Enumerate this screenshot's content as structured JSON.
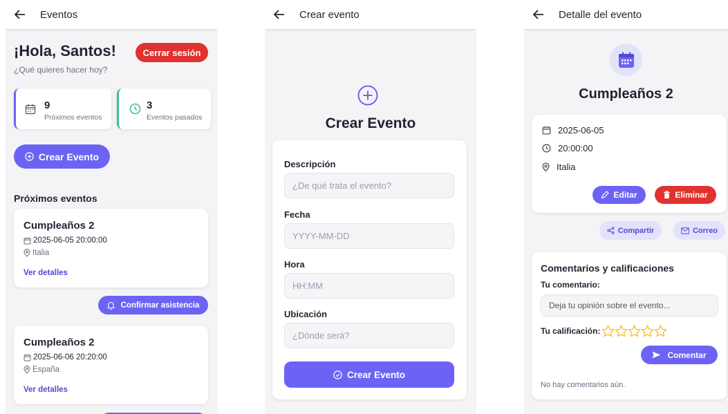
{
  "screen1": {
    "appbar_title": "Eventos",
    "greeting": "¡Hola, Santos!",
    "subtitle": "¿Qué quieres hacer hoy?",
    "logout_label": "Cerrar sesión",
    "stats": [
      {
        "value": "9",
        "label": "Próximos eventos"
      },
      {
        "value": "3",
        "label": "Eventos pasados"
      }
    ],
    "create_label": "Crear Evento",
    "section_title": "Próximos eventos",
    "events": [
      {
        "title": "Cumpleaños 2",
        "datetime": "2025-06-05 20:00:00",
        "location": "Italia",
        "details_label": "Ver detalles"
      },
      {
        "title": "Cumpleaños 2",
        "datetime": "2025-06-06 20:20:00",
        "location": "España",
        "details_label": "Ver detalles"
      }
    ],
    "confirm_label": "Confirmar asistencia"
  },
  "screen2": {
    "appbar_title": "Crear evento",
    "heading": "Crear Evento",
    "fields": [
      {
        "label": "Descripción",
        "placeholder": "¿De qué trata el evento?"
      },
      {
        "label": "Fecha",
        "placeholder": "YYYY-MM-DD"
      },
      {
        "label": "Hora",
        "placeholder": "HH:MM"
      },
      {
        "label": "Ubicación",
        "placeholder": "¿Dónde será?"
      }
    ],
    "submit_label": "Crear Evento"
  },
  "screen3": {
    "appbar_title": "Detalle del evento",
    "event_title": "Cumpleaños 2",
    "date": "2025-06-05",
    "time": "20:00:00",
    "location": "Italia",
    "edit_label": "Editar",
    "delete_label": "Eliminar",
    "share_label": "Compartir",
    "email_label": "Correo",
    "comments_title": "Comentarios y calificaciones",
    "your_comment_label": "Tu comentario:",
    "comment_placeholder": "Deja tu opinión sobre el evento...",
    "your_rating_label": "Tu calificación:",
    "rating_value": 0,
    "rating_max": 5,
    "comment_button": "Comentar",
    "no_comments": "No hay comentarios aún."
  },
  "colors": {
    "accent": "#6c63f5",
    "danger": "#e0322e",
    "green": "#34c58a",
    "star": "#f5b700"
  }
}
